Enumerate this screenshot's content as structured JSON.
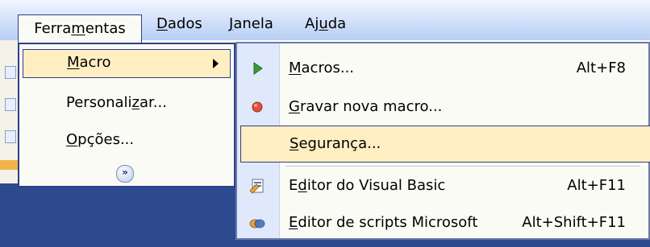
{
  "menubar": {
    "items": [
      {
        "pre": "Ferra",
        "ul": "m",
        "post": "entas"
      },
      {
        "pre": "",
        "ul": "D",
        "post": "ados"
      },
      {
        "pre": "",
        "ul": "J",
        "post": "anela"
      },
      {
        "pre": "Aj",
        "ul": "u",
        "post": "da"
      }
    ]
  },
  "menu1": {
    "items": [
      {
        "pre": "",
        "ul": "M",
        "post": "acro",
        "submenu": true
      },
      {
        "pre": "Personali",
        "ul": "z",
        "post": "ar..."
      },
      {
        "pre": "",
        "ul": "O",
        "post": "pções..."
      }
    ],
    "expand_glyph": "»"
  },
  "menu2": {
    "items": [
      {
        "pre": "",
        "ul": "M",
        "post": "acros...",
        "shortcut": "Alt+F8",
        "icon": "play-icon"
      },
      {
        "pre": "",
        "ul": "G",
        "post": "ravar nova macro...",
        "shortcut": "",
        "icon": "record-icon"
      },
      {
        "pre": "",
        "ul": "S",
        "post": "egurança...",
        "shortcut": "",
        "icon": ""
      },
      {
        "pre": "E",
        "ul": "d",
        "post": "itor do Visual Basic",
        "shortcut": "Alt+F11",
        "icon": "vb-editor-icon"
      },
      {
        "pre": "",
        "ul": "E",
        "post": "ditor de scripts Microsoft",
        "shortcut": "Alt+Shift+F11",
        "icon": "script-editor-icon"
      }
    ]
  },
  "colors": {
    "menubar_gradient": [
      "#f2f6ff",
      "#b8cff5"
    ],
    "highlight": "#ffeec2",
    "border": "#2e3e87",
    "gutter": "#dfe9fb"
  }
}
